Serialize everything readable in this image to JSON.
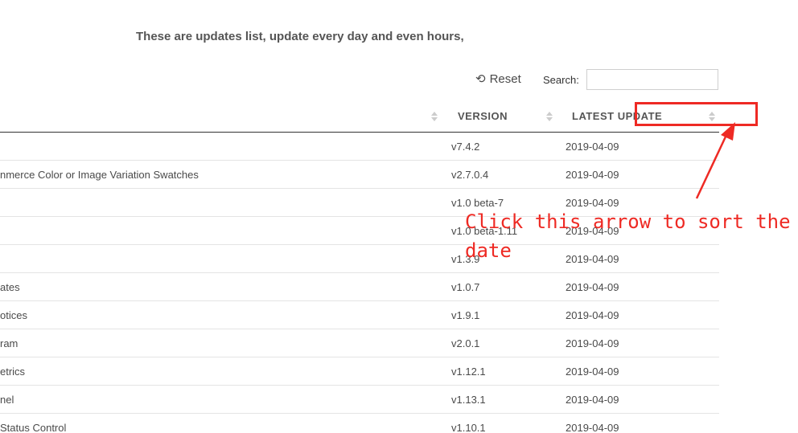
{
  "intro_text": "These are updates list, update every day and even hours,",
  "toolbar": {
    "reset_label": "Reset",
    "search_label": "Search:",
    "search_value": "",
    "search_placeholder": ""
  },
  "table": {
    "columns": [
      "",
      "VERSION",
      "LATEST UPDATE"
    ],
    "rows": [
      {
        "name": "",
        "version": "v7.4.2",
        "date": "2019-04-09"
      },
      {
        "name": "nmerce Color or Image Variation Swatches",
        "version": "v2.7.0.4",
        "date": "2019-04-09"
      },
      {
        "name": "",
        "version": "v1.0 beta-7",
        "date": "2019-04-09"
      },
      {
        "name": "",
        "version": "v1.0 beta-1.11",
        "date": "2019-04-09"
      },
      {
        "name": "",
        "version": "v1.3.9",
        "date": "2019-04-09"
      },
      {
        "name": "ates",
        "version": "v1.0.7",
        "date": "2019-04-09"
      },
      {
        "name": "otices",
        "version": "v1.9.1",
        "date": "2019-04-09"
      },
      {
        "name": "ram",
        "version": "v2.0.1",
        "date": "2019-04-09"
      },
      {
        "name": "etrics",
        "version": "v1.12.1",
        "date": "2019-04-09"
      },
      {
        "name": "nel",
        "version": "v1.13.1",
        "date": "2019-04-09"
      },
      {
        "name": "Status Control",
        "version": "v1.10.1",
        "date": "2019-04-09"
      }
    ]
  },
  "annotation": {
    "text": "Click this arrow to sort the date",
    "color": "#ee2a24"
  },
  "icons": {
    "reset": "undo-icon",
    "sort": "sort-arrows-icon"
  }
}
